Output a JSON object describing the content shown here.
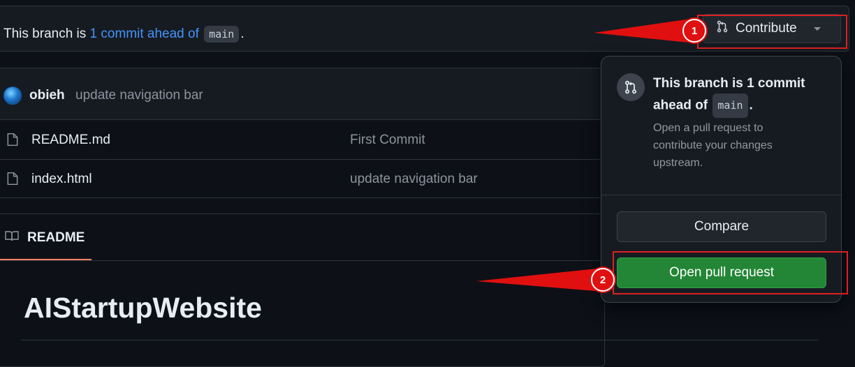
{
  "banner": {
    "prefix": "This branch is ",
    "ahead_link": "1 commit ahead of",
    "base_branch": "main",
    "suffix": ".",
    "contribute_label": "Contribute"
  },
  "latest_commit": {
    "author": "obieh",
    "message": "update navigation bar"
  },
  "files": [
    {
      "name": "README.md",
      "commit": "First Commit"
    },
    {
      "name": "index.html",
      "commit": "update navigation bar"
    }
  ],
  "readme": {
    "tab_label": "README",
    "heading": "AIStartupWebsite"
  },
  "popover": {
    "title_prefix": "This branch is 1 commit ahead of",
    "base_branch": "main",
    "title_suffix": ".",
    "description": "Open a pull request to contribute your changes upstream.",
    "compare_label": "Compare",
    "open_pr_label": "Open pull request"
  },
  "annotations": {
    "step1": "1",
    "step2": "2",
    "color": "#e01010"
  }
}
